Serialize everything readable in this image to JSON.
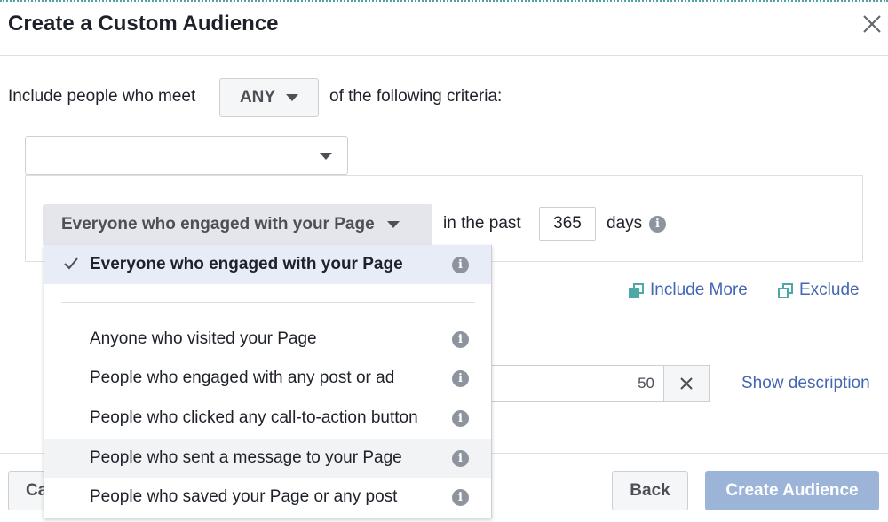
{
  "dialog": {
    "title": "Create a Custom Audience"
  },
  "criteria": {
    "prefix": "Include people who meet",
    "match_value": "ANY",
    "suffix": "of the following criteria:"
  },
  "rule": {
    "engagement_value": "Everyone who engaged with your Page",
    "in_the_past": "in the past",
    "days_value": "365",
    "days_label": "days"
  },
  "links": {
    "include_more": "Include More",
    "exclude": "Exclude",
    "show_description": "Show description"
  },
  "audience_name": {
    "char_count": "50"
  },
  "dropdown": {
    "items": [
      {
        "label": "Everyone who engaged with your Page",
        "selected": true
      },
      {
        "label": "Anyone who visited your Page"
      },
      {
        "label": "People who engaged with any post or ad"
      },
      {
        "label": "People who clicked any call-to-action button"
      },
      {
        "label": "People who sent a message to your Page",
        "hover": true
      },
      {
        "label": "People who saved your Page or any post"
      }
    ]
  },
  "footer": {
    "cancel_label": "Ca",
    "back_label": "Back",
    "create_label": "Create Audience"
  },
  "colors": {
    "link": "#4267b2",
    "accent_teal": "#4ca9a6",
    "create_disabled": "#9cb4d8",
    "selected_bg": "#e7ecf6"
  },
  "icons": {
    "close": "close-icon",
    "caret": "caret-down-icon",
    "info": "info-icon",
    "check": "check-icon",
    "include": "include-icon",
    "exclude": "exclude-icon",
    "clear": "clear-icon"
  }
}
